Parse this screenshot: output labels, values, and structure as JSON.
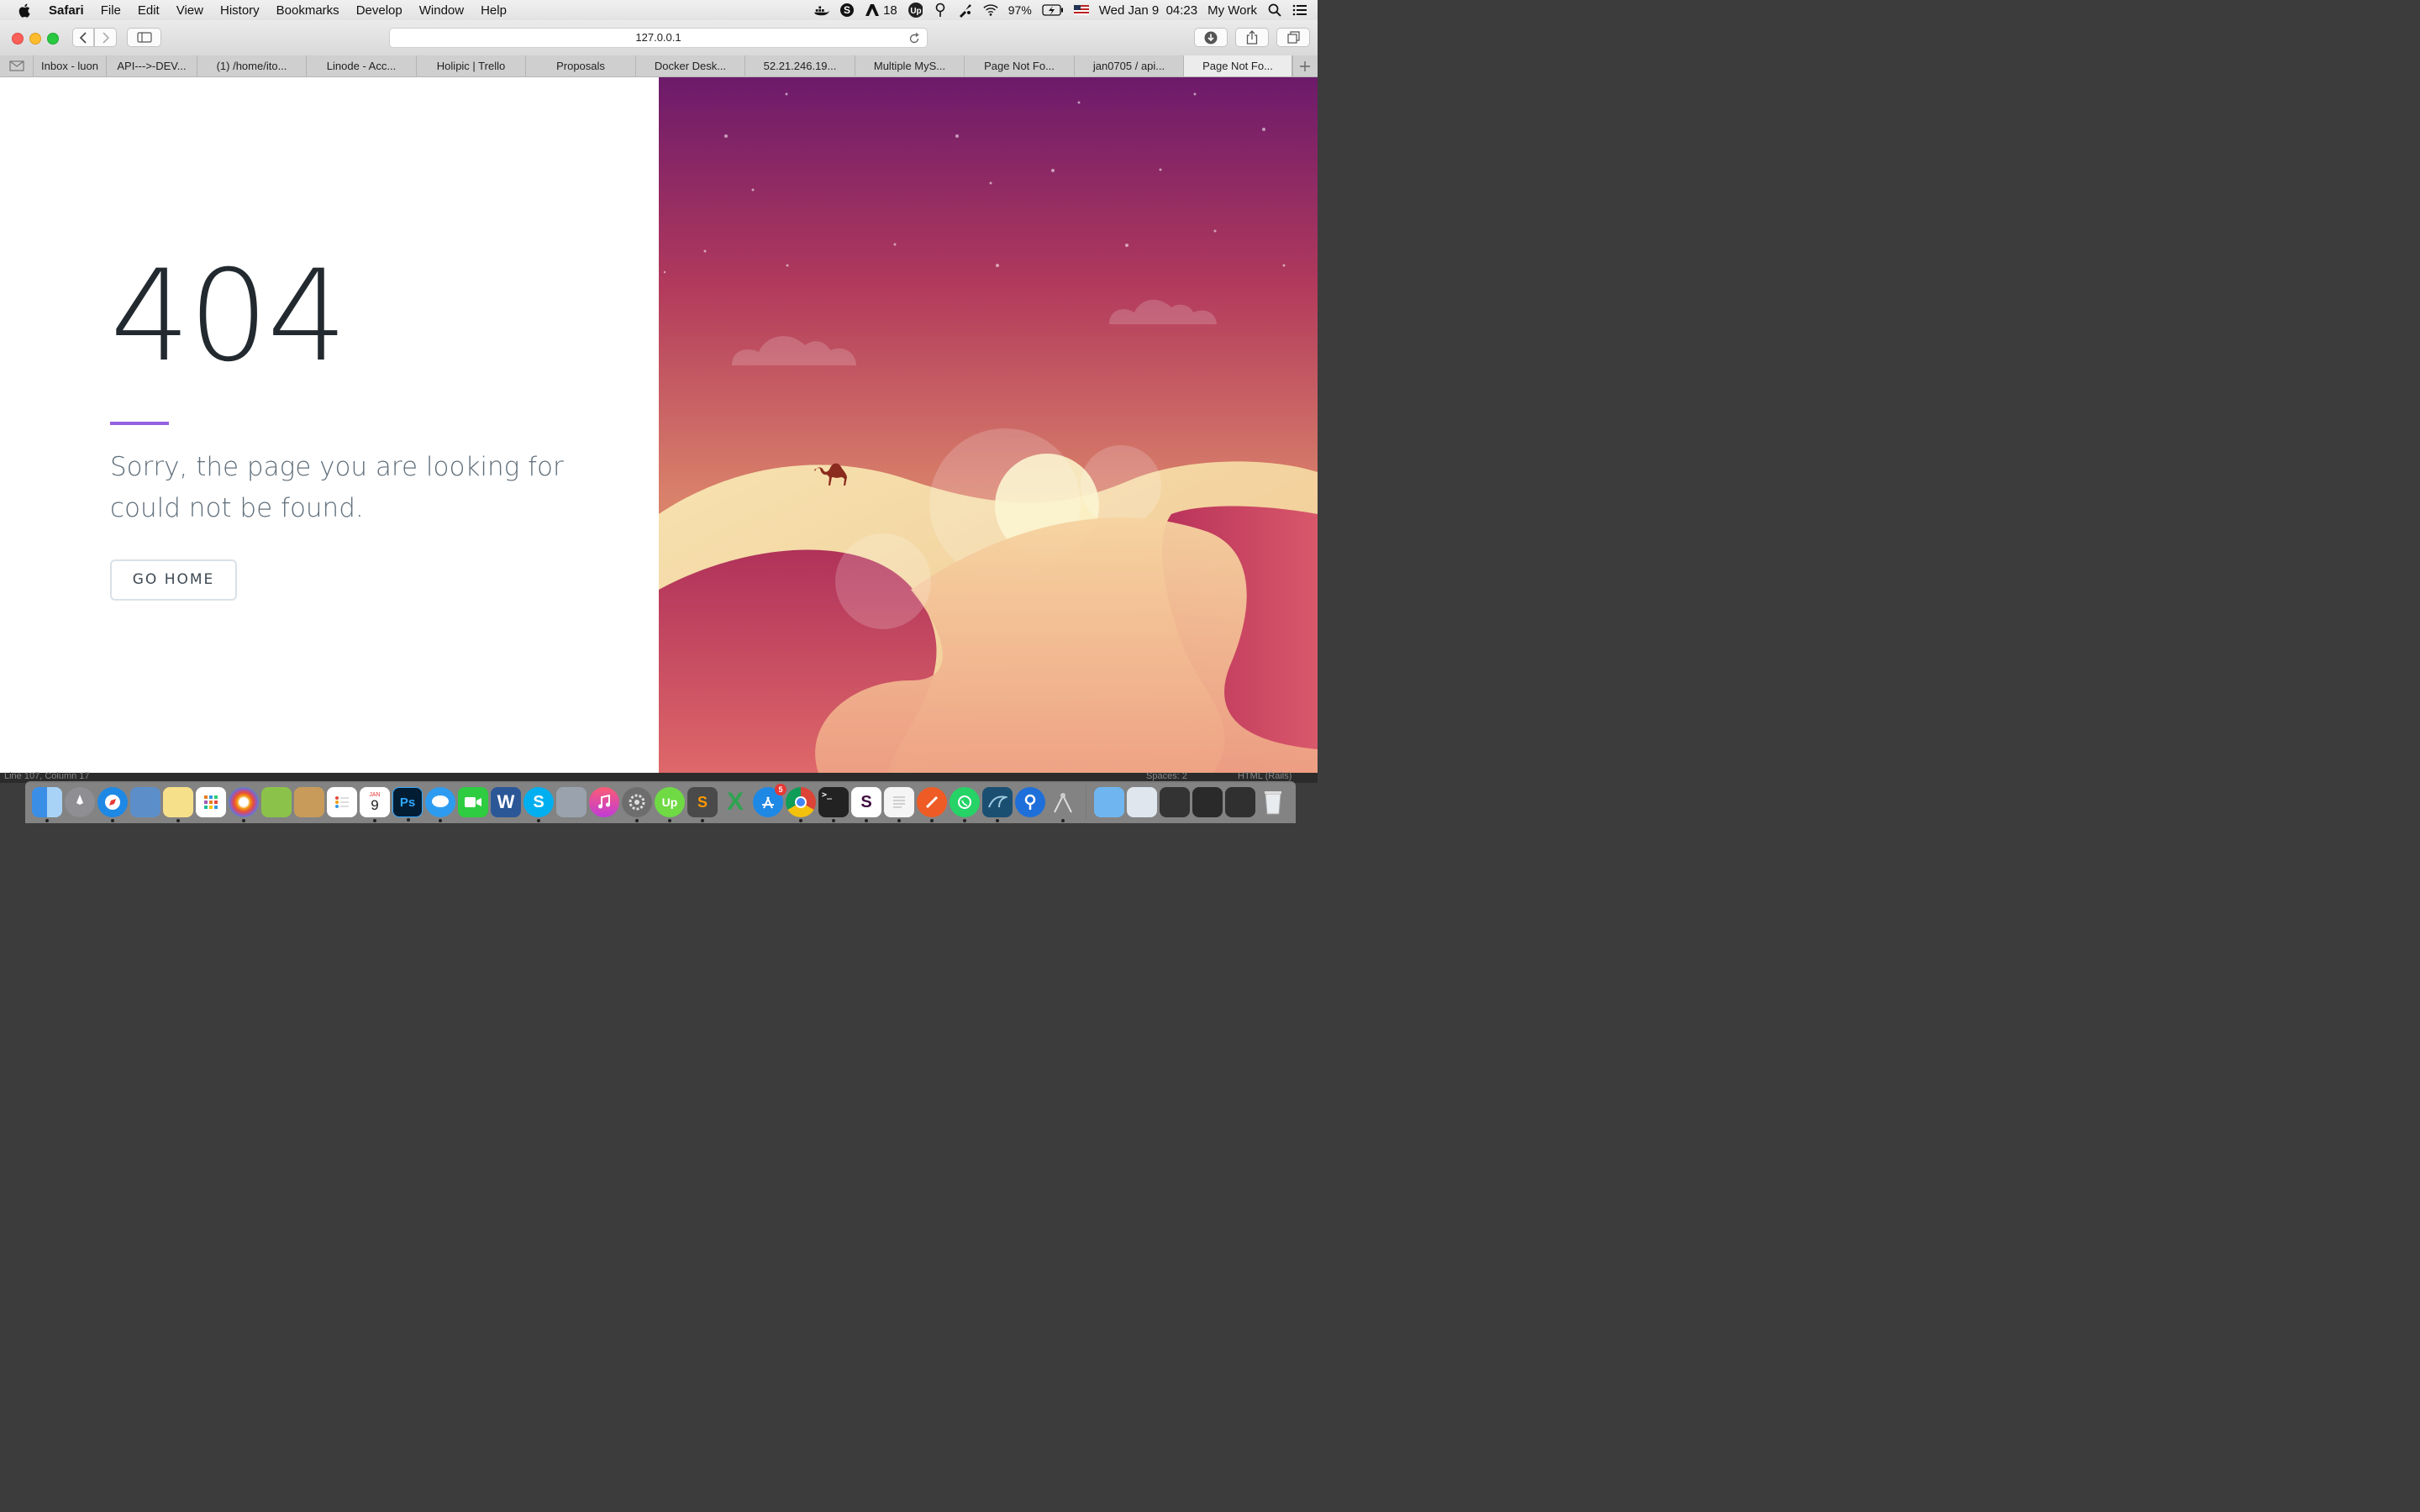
{
  "menubar": {
    "app": "Safari",
    "items": [
      "File",
      "Edit",
      "View",
      "History",
      "Bookmarks",
      "Develop",
      "Window",
      "Help"
    ],
    "tray": {
      "notification_count": "18",
      "battery": "97%",
      "datetime": "Wed Jan 9  04:23",
      "workspace": "My Work"
    }
  },
  "browser": {
    "address": "127.0.0.1",
    "tabs": [
      {
        "label": "Inbox - luon",
        "active": false
      },
      {
        "label": "API--->-DEV...",
        "active": false
      },
      {
        "label": "(1) /home/ito...",
        "active": false
      },
      {
        "label": "Linode - Acc...",
        "active": false
      },
      {
        "label": "Holipic | Trello",
        "active": false
      },
      {
        "label": "Proposals",
        "active": false
      },
      {
        "label": "Docker Desk...",
        "active": false
      },
      {
        "label": "52.21.246.19...",
        "active": false
      },
      {
        "label": "Multiple MyS...",
        "active": false
      },
      {
        "label": "Page Not Fo...",
        "active": false
      },
      {
        "label": "jan0705 / api...",
        "active": false
      },
      {
        "label": "Page Not Fo...",
        "active": true
      }
    ]
  },
  "page": {
    "code": "404",
    "message": "Sorry, the page you are looking for could not be found.",
    "button": "GO HOME",
    "accent_color": "#9561e2"
  },
  "editor_status": {
    "position": "Line 107, Column 17",
    "spaces": "Spaces: 2",
    "syntax": "HTML (Rails)"
  },
  "dock": {
    "calendar_month": "JAN",
    "calendar_day": "9",
    "appstore_badge": "5",
    "apps": [
      "finder",
      "launchpad",
      "safari",
      "mail-stamp",
      "notes",
      "launchpad-grid",
      "photos",
      "maps",
      "contacts",
      "reminders",
      "calendar",
      "photoshop",
      "messages",
      "facetime",
      "word",
      "skype",
      "system-utility",
      "itunes",
      "system-preferences",
      "upwork",
      "sublime",
      "excel",
      "app-store",
      "chrome",
      "terminal",
      "slack",
      "textedit",
      "postman",
      "whatsapp",
      "mysql-workbench",
      "sourcetree",
      "airport-utility"
    ]
  }
}
